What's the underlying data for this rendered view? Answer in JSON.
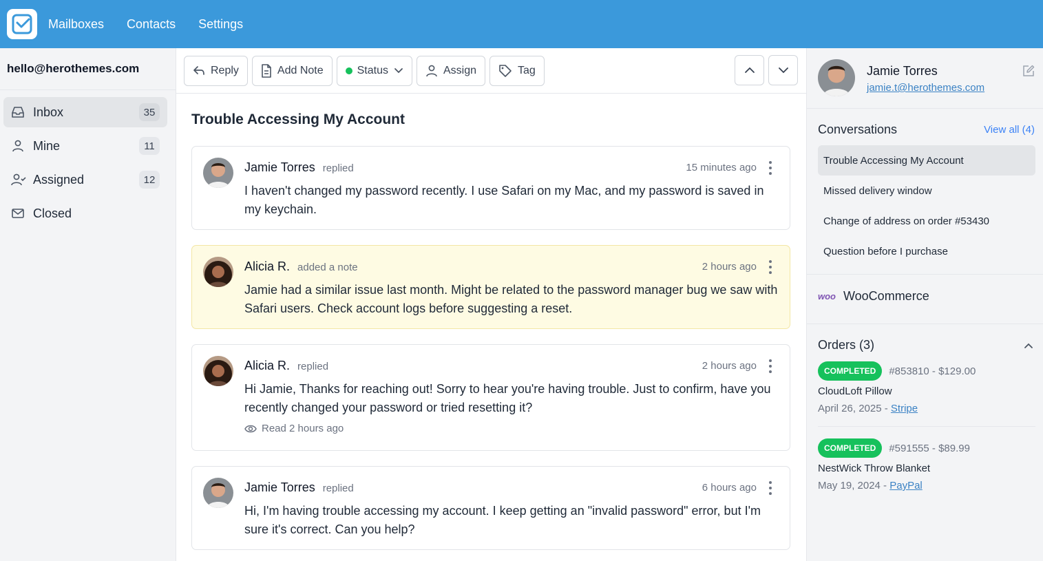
{
  "topnav": {
    "items": [
      "Mailboxes",
      "Contacts",
      "Settings"
    ]
  },
  "sidebar": {
    "email": "hello@herothemes.com",
    "items": [
      {
        "label": "Inbox",
        "count": "35",
        "icon": "inbox-icon"
      },
      {
        "label": "Mine",
        "count": "11",
        "icon": "user-icon"
      },
      {
        "label": "Assigned",
        "count": "12",
        "icon": "user-check-icon"
      },
      {
        "label": "Closed",
        "count": "",
        "icon": "mail-icon"
      }
    ]
  },
  "toolbar": {
    "reply": "Reply",
    "add_note": "Add Note",
    "status": "Status",
    "assign": "Assign",
    "tag": "Tag"
  },
  "conversation": {
    "title": "Trouble Accessing My Account",
    "messages": [
      {
        "name": "Jamie Torres",
        "action": "replied",
        "time": "15 minutes ago",
        "body": "I haven't changed my password recently. I use Safari on my Mac, and my password is saved in my keychain.",
        "avatar": "male"
      },
      {
        "name": "Alicia R.",
        "action": "added a note",
        "time": "2 hours ago",
        "body": "Jamie had a similar issue last month. Might be related to the password manager bug we saw with Safari users. Check account logs before suggesting a reset.",
        "avatar": "female"
      },
      {
        "name": "Alicia R.",
        "action": "replied",
        "time": "2 hours ago",
        "body": "Hi Jamie, Thanks for reaching out! Sorry to hear you're having trouble. Just to confirm, have you recently changed your password or tried resetting it?",
        "read": "Read 2 hours ago",
        "avatar": "female"
      },
      {
        "name": "Jamie Torres",
        "action": "replied",
        "time": "6 hours ago",
        "body": "Hi, I'm having trouble accessing my account. I keep getting an \"invalid password\" error, but I'm sure it's correct. Can you help?",
        "avatar": "male"
      }
    ]
  },
  "contact": {
    "name": "Jamie Torres",
    "email": "jamie.t@herothemes.com"
  },
  "conversations_panel": {
    "title": "Conversations",
    "view_all": "View all (4)",
    "items": [
      "Trouble Accessing My Account",
      "Missed delivery window",
      "Change of address on order #53430",
      "Question before I purchase"
    ]
  },
  "woocommerce": {
    "logo": "woo",
    "name": "WooCommerce"
  },
  "orders": {
    "title": "Orders (3)",
    "items": [
      {
        "status": "COMPLETED",
        "number": "#853810 - $129.00",
        "product": "CloudLoft Pillow",
        "date": "April 26, 2025 - ",
        "gateway": "Stripe"
      },
      {
        "status": "COMPLETED",
        "number": "#591555 - $89.99",
        "product": "NestWick Throw Blanket",
        "date": "May 19, 2024 - ",
        "gateway": "PayPal"
      }
    ]
  },
  "colors": {
    "topbar": "#3b99db",
    "status_green": "#16c15c",
    "link": "#3b82c4",
    "note_bg": "#fefbe3"
  }
}
